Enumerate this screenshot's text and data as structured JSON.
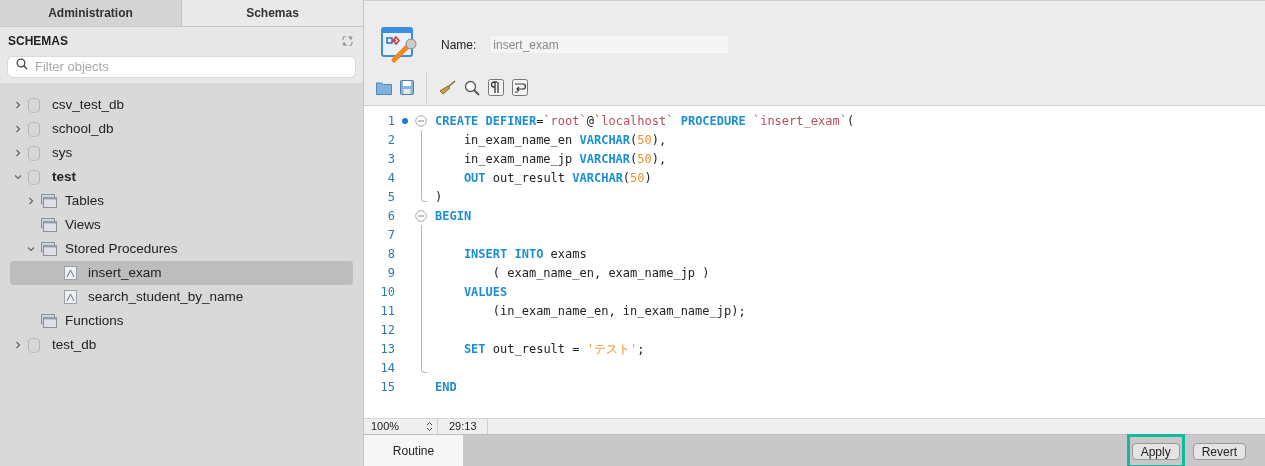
{
  "sidebar": {
    "tabs": [
      {
        "label": "Administration",
        "selected": false
      },
      {
        "label": "Schemas",
        "selected": true
      }
    ],
    "heading": "SCHEMAS",
    "filter": {
      "placeholder": "Filter objects"
    },
    "tree": [
      {
        "label": "csv_test_db",
        "kind": "schema",
        "expanded": false,
        "selected": false,
        "default": false
      },
      {
        "label": "school_db",
        "kind": "schema",
        "expanded": false,
        "selected": false,
        "default": false
      },
      {
        "label": "sys",
        "kind": "schema",
        "expanded": false,
        "selected": false,
        "default": false
      },
      {
        "label": "test",
        "kind": "schema",
        "expanded": true,
        "selected": false,
        "default": true,
        "children": [
          {
            "label": "Tables",
            "kind": "folder",
            "expanded": false,
            "selected": false,
            "default": false
          },
          {
            "label": "Views",
            "kind": "folder",
            "selected": false,
            "default": false
          },
          {
            "label": "Stored Procedures",
            "kind": "folder",
            "expanded": true,
            "selected": false,
            "default": false,
            "children": [
              {
                "label": "insert_exam",
                "kind": "routine",
                "selected": true,
                "default": false
              },
              {
                "label": "search_student_by_name",
                "kind": "routine",
                "selected": false,
                "default": false
              }
            ]
          },
          {
            "label": "Functions",
            "kind": "folder",
            "selected": false,
            "default": false
          }
        ]
      },
      {
        "label": "test_db",
        "kind": "schema",
        "expanded": false,
        "selected": false,
        "default": false
      }
    ]
  },
  "editor": {
    "name_label": "Name:",
    "name_value": "insert_exam",
    "lines": [
      {
        "number": "1",
        "fold_start": true,
        "fold_body": false,
        "fold_end": false,
        "breakpoint": true,
        "tokens": [
          {
            "kind": "kw",
            "text": "CREATE DEFINER"
          },
          {
            "kind": "plain",
            "text": "="
          },
          {
            "kind": "ident",
            "text": "`root`"
          },
          {
            "kind": "plain",
            "text": "@"
          },
          {
            "kind": "ident",
            "text": "`localhost`"
          },
          {
            "kind": "kw",
            "text": " PROCEDURE"
          },
          {
            "kind": "ident",
            "text": " `insert_exam`"
          },
          {
            "kind": "plain",
            "text": "("
          }
        ]
      },
      {
        "number": "2",
        "fold_start": false,
        "fold_body": true,
        "fold_end": false,
        "breakpoint": false,
        "tokens": [
          {
            "kind": "plain",
            "text": "    in_exam_name_en "
          },
          {
            "kind": "kw",
            "text": "VARCHAR"
          },
          {
            "kind": "plain",
            "text": "("
          },
          {
            "kind": "num",
            "text": "50"
          },
          {
            "kind": "plain",
            "text": "),"
          }
        ]
      },
      {
        "number": "3",
        "fold_start": false,
        "fold_body": true,
        "fold_end": false,
        "breakpoint": false,
        "tokens": [
          {
            "kind": "plain",
            "text": "    in_exam_name_jp "
          },
          {
            "kind": "kw",
            "text": "VARCHAR"
          },
          {
            "kind": "plain",
            "text": "("
          },
          {
            "kind": "num",
            "text": "50"
          },
          {
            "kind": "plain",
            "text": "),"
          }
        ]
      },
      {
        "number": "4",
        "fold_start": false,
        "fold_body": true,
        "fold_end": false,
        "breakpoint": false,
        "tokens": [
          {
            "kind": "kw",
            "text": "    OUT"
          },
          {
            "kind": "plain",
            "text": " out_result "
          },
          {
            "kind": "kw",
            "text": "VARCHAR"
          },
          {
            "kind": "plain",
            "text": "("
          },
          {
            "kind": "num",
            "text": "50"
          },
          {
            "kind": "plain",
            "text": ")"
          }
        ]
      },
      {
        "number": "5",
        "fold_start": false,
        "fold_body": false,
        "fold_end": true,
        "breakpoint": false,
        "tokens": [
          {
            "kind": "plain",
            "text": ")"
          }
        ]
      },
      {
        "number": "6",
        "fold_start": true,
        "fold_body": false,
        "fold_end": false,
        "breakpoint": false,
        "tokens": [
          {
            "kind": "kw",
            "text": "BEGIN"
          }
        ]
      },
      {
        "number": "7",
        "fold_start": false,
        "fold_body": true,
        "fold_end": false,
        "breakpoint": false
      },
      {
        "number": "8",
        "fold_start": false,
        "fold_body": true,
        "fold_end": false,
        "breakpoint": false,
        "tokens": [
          {
            "kind": "kw",
            "text": "    INSERT INTO"
          },
          {
            "kind": "plain",
            "text": " exams"
          }
        ]
      },
      {
        "number": "9",
        "fold_start": false,
        "fold_body": true,
        "fold_end": false,
        "breakpoint": false,
        "tokens": [
          {
            "kind": "plain",
            "text": "        ( exam_name_en, exam_name_jp )"
          }
        ]
      },
      {
        "number": "10",
        "fold_start": false,
        "fold_body": true,
        "fold_end": false,
        "breakpoint": false,
        "tokens": [
          {
            "kind": "kw",
            "text": "    VALUES"
          }
        ]
      },
      {
        "number": "11",
        "fold_start": false,
        "fold_body": true,
        "fold_end": false,
        "breakpoint": false,
        "tokens": [
          {
            "kind": "plain",
            "text": "        (in_exam_name_en, in_exam_name_jp);"
          }
        ]
      },
      {
        "number": "12",
        "fold_start": false,
        "fold_body": true,
        "fold_end": false,
        "breakpoint": false
      },
      {
        "number": "13",
        "fold_start": false,
        "fold_body": true,
        "fold_end": false,
        "breakpoint": false,
        "tokens": [
          {
            "kind": "kw",
            "text": "    SET"
          },
          {
            "kind": "plain",
            "text": " out_result = "
          },
          {
            "kind": "str",
            "text": "'テスト'"
          },
          {
            "kind": "plain",
            "text": ";"
          }
        ]
      },
      {
        "number": "14",
        "fold_start": false,
        "fold_body": false,
        "fold_end": true,
        "breakpoint": false
      },
      {
        "number": "15",
        "fold_start": false,
        "fold_body": false,
        "fold_end": false,
        "breakpoint": false,
        "tokens": [
          {
            "kind": "kw",
            "text": "END"
          }
        ]
      }
    ],
    "status": {
      "zoom": "100%",
      "position": "29:13"
    }
  },
  "bottom_tabs": [
    {
      "label": "Routine",
      "selected": true
    }
  ],
  "buttons": [
    {
      "label": "Apply",
      "highlighted": true
    },
    {
      "label": "Revert",
      "highlighted": false
    }
  ]
}
